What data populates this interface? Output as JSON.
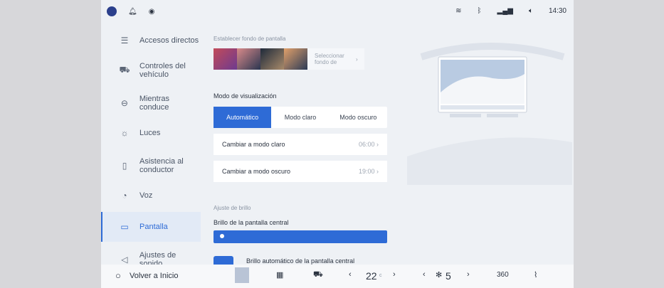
{
  "status": {
    "time": "14:30"
  },
  "sidebar": {
    "items": [
      {
        "label": "Accesos directos",
        "icon": "shortcuts-icon"
      },
      {
        "label": "Controles del vehículo",
        "icon": "car-controls-icon"
      },
      {
        "label": "Mientras conduce",
        "icon": "steering-wheel-icon"
      },
      {
        "label": "Luces",
        "icon": "light-bulb-icon"
      },
      {
        "label": "Asistencia al conductor",
        "icon": "driver-assist-icon"
      },
      {
        "label": "Voz",
        "icon": "voice-icon"
      },
      {
        "label": "Pantalla",
        "icon": "display-icon",
        "active": true
      },
      {
        "label": "Ajustes de sonido",
        "icon": "speaker-icon"
      }
    ]
  },
  "main": {
    "wallpaper_label": "Establecer fondo de pantalla",
    "wallpaper_button": "Seleccionar fondo de",
    "display_mode_title": "Modo de visualización",
    "modes": [
      "Automático",
      "Modo claro",
      "Modo oscuro"
    ],
    "selected_mode": "Automático",
    "rows": [
      {
        "label": "Cambiar a modo claro",
        "value": "06:00"
      },
      {
        "label": "Cambiar a modo oscuro",
        "value": "19:00"
      }
    ],
    "brightness_section": "Ajuste de brillo",
    "brightness_label": "Brillo de la pantalla central",
    "auto_brightness_label": "Brillo automático de la pantalla central"
  },
  "bottom": {
    "home_label": "Volver a Inicio",
    "temp": "22",
    "temp_unit": "c",
    "fan": "5",
    "view_360": "360"
  },
  "colors": {
    "accent": "#2e6bd6",
    "background": "#eef1f5"
  }
}
